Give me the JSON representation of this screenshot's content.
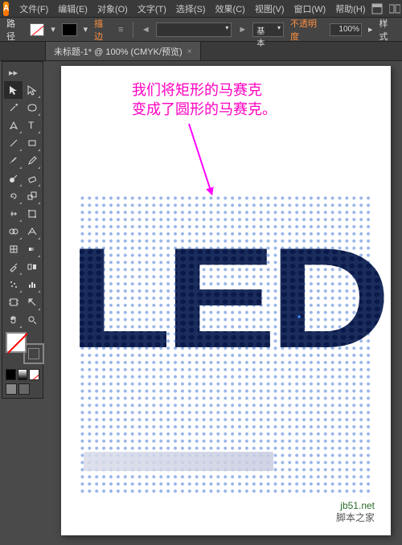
{
  "app": {
    "logo_letter": "A"
  },
  "menu": {
    "items": [
      "文件(F)",
      "编辑(E)",
      "对象(O)",
      "文字(T)",
      "选择(S)",
      "效果(C)",
      "视图(V)",
      "窗口(W)",
      "帮助(H)"
    ]
  },
  "optionbar": {
    "tool_label": "路径",
    "stroke_label": "描边",
    "basic_label": "基本",
    "opacity_label": "不透明度",
    "opacity_value": "100%",
    "style_label": "样式"
  },
  "document": {
    "tab_title": "未标题-1* @ 100% (CMYK/预览)"
  },
  "annotation": {
    "line1": "我们将矩形的马赛克",
    "line2": "变成了圆形的马赛克。"
  },
  "artwork": {
    "text": "LED"
  },
  "watermark": {
    "url": "jb51.net",
    "name": "脚本之家"
  },
  "colors": {
    "accent_pink": "#ff00c0",
    "led_dark": "#0b1a4a",
    "grid_blue": "#4a7ad6"
  },
  "tools": [
    [
      "selection",
      "direct-selection"
    ],
    [
      "magic-wand",
      "lasso"
    ],
    [
      "pen",
      "type"
    ],
    [
      "line-segment",
      "rectangle"
    ],
    [
      "paintbrush",
      "pencil"
    ],
    [
      "blob-brush",
      "eraser"
    ],
    [
      "rotate",
      "scale"
    ],
    [
      "width",
      "free-transform"
    ],
    [
      "shape-builder",
      "perspective-grid"
    ],
    [
      "mesh",
      "gradient"
    ],
    [
      "eyedropper",
      "blend"
    ],
    [
      "symbol-sprayer",
      "column-graph"
    ],
    [
      "artboard",
      "slice"
    ],
    [
      "hand",
      "zoom"
    ]
  ]
}
